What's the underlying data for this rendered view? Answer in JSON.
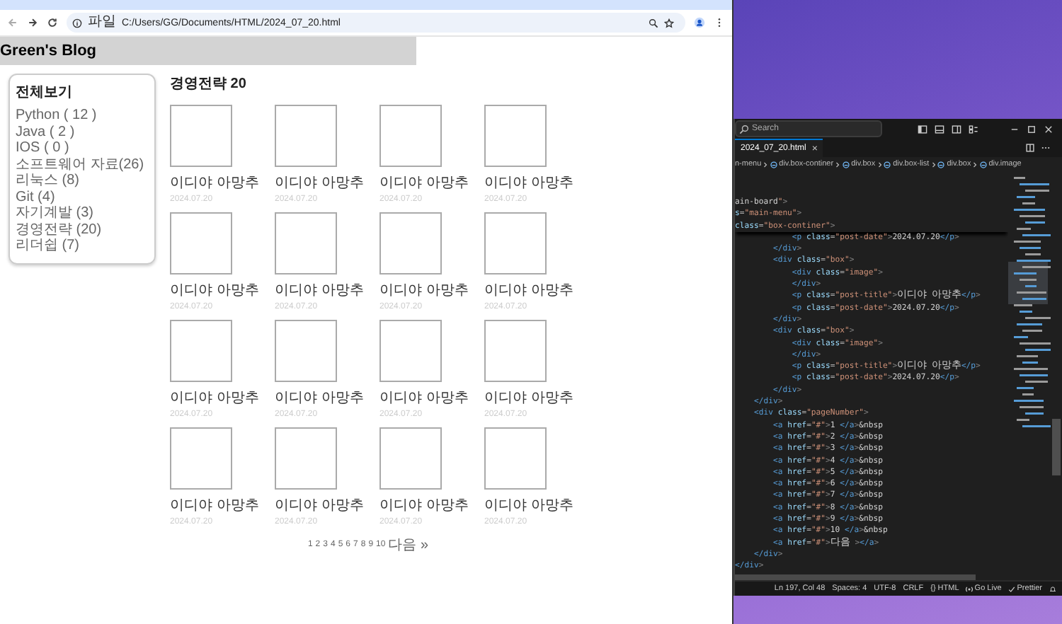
{
  "browser": {
    "address": {
      "chip": "파일",
      "url": "C:/Users/GG/Documents/HTML/2024_07_20.html"
    }
  },
  "blog": {
    "title": "Green's Blog",
    "sidebar": {
      "heading": "전체보기",
      "categories": [
        "Python ( 12 )",
        "Java ( 2 )",
        "IOS ( 0 )",
        "소프트웨어 자료(26)",
        "리눅스 (8)",
        "Git (4)",
        "자기계발 (3)",
        "경영전략 (20)",
        "리더쉽 (7)"
      ]
    },
    "section_title": "경영전략 20",
    "posts": [
      {
        "title": "이디야 아망추",
        "date": "2024.07.20"
      },
      {
        "title": "이디야 아망추",
        "date": "2024.07.20"
      },
      {
        "title": "이디야 아망추",
        "date": "2024.07.20"
      },
      {
        "title": "이디야 아망추",
        "date": "2024.07.20"
      },
      {
        "title": "이디야 아망추",
        "date": "2024.07.20"
      },
      {
        "title": "이디야 아망추",
        "date": "2024.07.20"
      },
      {
        "title": "이디야 아망추",
        "date": "2024.07.20"
      },
      {
        "title": "이디야 아망추",
        "date": "2024.07.20"
      },
      {
        "title": "이디야 아망추",
        "date": "2024.07.20"
      },
      {
        "title": "이디야 아망추",
        "date": "2024.07.20"
      },
      {
        "title": "이디야 아망추",
        "date": "2024.07.20"
      },
      {
        "title": "이디야 아망추",
        "date": "2024.07.20"
      },
      {
        "title": "이디야 아망추",
        "date": "2024.07.20"
      },
      {
        "title": "이디야 아망추",
        "date": "2024.07.20"
      },
      {
        "title": "이디야 아망추",
        "date": "2024.07.20"
      },
      {
        "title": "이디야 아망추",
        "date": "2024.07.20"
      }
    ],
    "pagination": [
      "1",
      "2",
      "3",
      "4",
      "5",
      "6",
      "7",
      "8",
      "9",
      "10",
      "다음 »"
    ]
  },
  "editor": {
    "search_placeholder": "Search",
    "tab": {
      "label": "2024_07_20.html",
      "close": "×"
    },
    "breadcrumbs": [
      "n-menu",
      "div.box-continer",
      "div.box",
      "div.box-list",
      "div.box",
      "div.image"
    ],
    "code_lines": [
      "ain-board\">",
      "s=\"main-menu\">",
      "class=\"box-continer\">",
      "            <p class=\"post-date\">2024.07.20</p>",
      "        </div>",
      "        <div class=\"box\">",
      "            <div class=\"image\">",
      "            </div>",
      "            <p class=\"post-title\">이디야 아망추</p>",
      "            <p class=\"post-date\">2024.07.20</p>",
      "        </div>",
      "        <div class=\"box\">",
      "            <div class=\"image\">",
      "            </div>",
      "            <p class=\"post-title\">이디야 아망추</p>",
      "            <p class=\"post-date\">2024.07.20</p>",
      "        </div>",
      "    </div>",
      "    <div class=\"pageNumber\">",
      "        <a href=\"#\">1 </a>&nbsp",
      "        <a href=\"#\">2 </a>&nbsp",
      "        <a href=\"#\">3 </a>&nbsp",
      "        <a href=\"#\">4 </a>&nbsp",
      "        <a href=\"#\">5 </a>&nbsp",
      "        <a href=\"#\">6 </a>&nbsp",
      "        <a href=\"#\">7 </a>&nbsp",
      "        <a href=\"#\">8 </a>&nbsp",
      "        <a href=\"#\">9 </a>&nbsp",
      "        <a href=\"#\">10 </a>&nbsp",
      "        <a href=\"#\">다음 ></a>",
      "    </div>",
      "</div>"
    ],
    "status_bar": [
      {
        "label": "Ln 197, Col 48"
      },
      {
        "label": "Spaces: 4"
      },
      {
        "label": "UTF-8"
      },
      {
        "label": "CRLF"
      },
      {
        "label": "{} HTML"
      },
      {
        "label": "Go Live",
        "kind": "broadcast"
      },
      {
        "label": "Prettier",
        "kind": "check"
      }
    ]
  }
}
